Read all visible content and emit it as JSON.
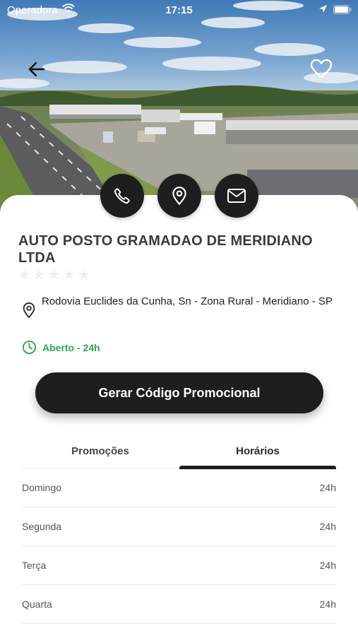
{
  "status_bar": {
    "carrier": "Operadora",
    "time": "17:15"
  },
  "place": {
    "name": "AUTO POSTO GRAMADAO DE MERIDIANO LTDA",
    "rating": 0,
    "rating_max": 5,
    "address": "Rodovia Euclides da Cunha, Sn - Zona Rural - Meridiano - SP",
    "open_status": "Aberto - 24h"
  },
  "actions": {
    "promo_button": "Gerar Código Promocional"
  },
  "tabs": [
    {
      "label": "Promoções",
      "active": false
    },
    {
      "label": "Horários",
      "active": true
    }
  ],
  "schedule": [
    {
      "day": "Domingo",
      "hours": "24h"
    },
    {
      "day": "Segunda",
      "hours": "24h"
    },
    {
      "day": "Terça",
      "hours": "24h"
    },
    {
      "day": "Quarta",
      "hours": "24h"
    }
  ],
  "icons": {
    "back": "arrow-left-icon",
    "favorite": "heart-outline-icon",
    "call": "phone-icon",
    "map": "map-pin-icon",
    "mail": "mail-icon",
    "address": "map-pin-icon",
    "hours": "clock-icon"
  },
  "colors": {
    "accent_dark": "#1e1e1e",
    "open_green": "#2aa84f"
  }
}
